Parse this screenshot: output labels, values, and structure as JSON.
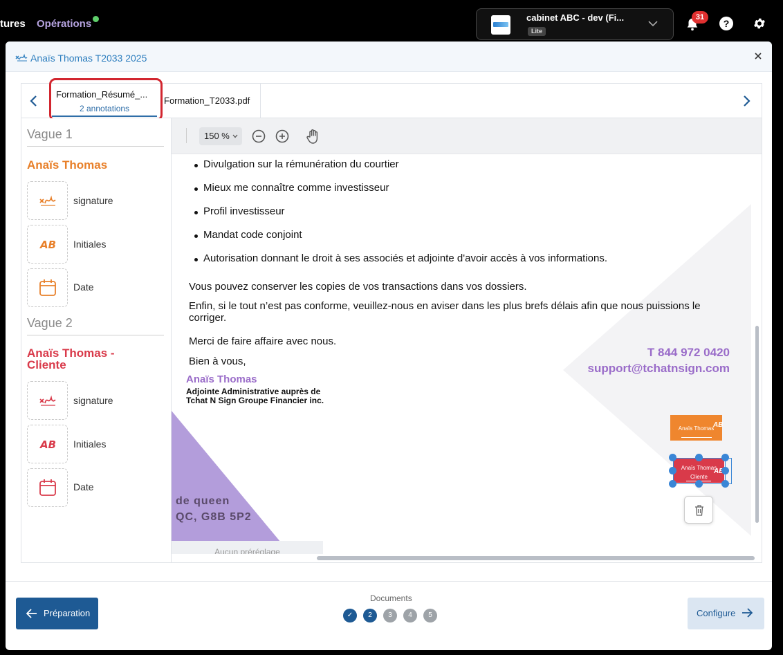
{
  "topbar": {
    "nav_partial": "tures",
    "nav_operations": "Opérations",
    "org_name": "cabinet ABC - dev (Fi...",
    "org_plan": "Lite",
    "notification_count": "31",
    "help_glyph": "?"
  },
  "modal": {
    "title": "Anaïs Thomas T2033 2025",
    "tabs": [
      {
        "name": "Formation_Résumé_...",
        "subtitle": "2 annotations"
      },
      {
        "name": "Formation_T2033.pdf"
      }
    ]
  },
  "sidebar": {
    "waves": [
      {
        "label": "Vague 1",
        "signer": "Anaïs Thomas",
        "color": "#e8802a",
        "fields": [
          {
            "label": "signature",
            "icon": "signature-icon"
          },
          {
            "label": "Initiales",
            "icon": "initials-icon"
          },
          {
            "label": "Date",
            "icon": "calendar-icon"
          }
        ]
      },
      {
        "label": "Vague 2",
        "signer": "Anaïs Thomas - Cliente",
        "color": "#d93a4a",
        "fields": [
          {
            "label": "signature",
            "icon": "signature-icon"
          },
          {
            "label": "Initiales",
            "icon": "initials-icon"
          },
          {
            "label": "Date",
            "icon": "calendar-icon"
          }
        ]
      }
    ]
  },
  "viewer": {
    "zoom": "150 %",
    "bullets": [
      "Divulgation sur la rémunération du courtier",
      "Mieux me connaître comme investisseur",
      "Profil investisseur",
      "Mandat code conjoint",
      "Autorisation donnant le droit à ses associés et adjointe d'avoir accès à vos informations."
    ],
    "para_copies": "Vous pouvez conserver les copies de vos transactions dans vos dossiers.",
    "para_conform": "Enfin, si le tout n’est pas conforme, veuillez-nous en aviser dans les plus brefs délais afin que nous puissions le corriger.",
    "para_thanks": "Merci de faire affaire avec nous.",
    "para_regards": "Bien à vous,",
    "sig_name": "Anaïs Thomas",
    "sig_role_1": "Adjointe Administrative auprès de",
    "sig_role_2": "Tchat N Sign Groupe Financier inc.",
    "phone": "T 844 972 0420",
    "email": "support@tchatnsign.com",
    "address_1": "de queen",
    "address_2": "QC, G8B 5P2",
    "stamp_orange": {
      "name": "Anaïs Thomas",
      "initials": "AB"
    },
    "stamp_red": {
      "name": "Anaïs Thomas",
      "role": "Cliente",
      "initials": "AB"
    },
    "preset_label": "Aucun préréglage"
  },
  "footer": {
    "prev_label": "Préparation",
    "docs_label": "Documents",
    "steps": [
      "✓",
      "2",
      "3",
      "4",
      "5"
    ],
    "current_step": 2,
    "next_label": "Configure"
  },
  "colors": {
    "primary": "#1e5a94",
    "accent_purple": "#9a6cc9",
    "signer_orange": "#e8802a",
    "signer_red": "#d93a4a",
    "highlight_red": "#d2262f"
  }
}
